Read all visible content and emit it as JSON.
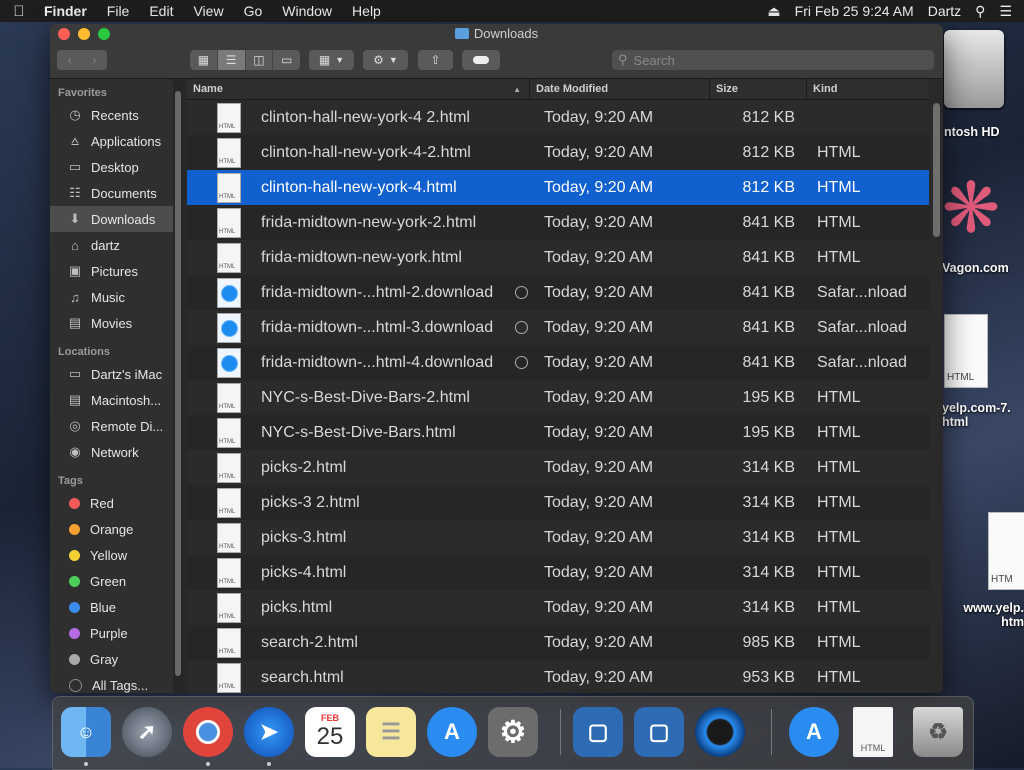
{
  "menubar": {
    "app": "Finder",
    "menus": [
      "File",
      "Edit",
      "View",
      "Go",
      "Window",
      "Help"
    ],
    "datetime": "Fri Feb 25  9:24 AM",
    "user": "Dartz"
  },
  "desktop": {
    "hd_label": "ntosh HD",
    "wagon_label": "Vagon.com",
    "doc1_label": "yelp.com-7.\nhtml",
    "doc1_tag": "HTML",
    "doc2_label": "www.yelp.\nhtm",
    "doc2_tag": "HTM"
  },
  "window": {
    "title": "Downloads",
    "search_placeholder": "Search"
  },
  "sidebar": {
    "favorites_header": "Favorites",
    "favorites": [
      {
        "label": "Recents",
        "icon": "clock-icon"
      },
      {
        "label": "Applications",
        "icon": "applications-icon"
      },
      {
        "label": "Desktop",
        "icon": "desktop-icon"
      },
      {
        "label": "Documents",
        "icon": "documents-icon"
      },
      {
        "label": "Downloads",
        "icon": "downloads-icon",
        "selected": true
      },
      {
        "label": "dartz",
        "icon": "home-icon"
      },
      {
        "label": "Pictures",
        "icon": "pictures-icon"
      },
      {
        "label": "Music",
        "icon": "music-icon"
      },
      {
        "label": "Movies",
        "icon": "movies-icon"
      }
    ],
    "locations_header": "Locations",
    "locations": [
      {
        "label": "Dartz's iMac",
        "icon": "imac-icon"
      },
      {
        "label": "Macintosh...",
        "icon": "drive-icon"
      },
      {
        "label": "Remote Di...",
        "icon": "disc-icon"
      },
      {
        "label": "Network",
        "icon": "network-icon"
      }
    ],
    "tags_header": "Tags",
    "tags": [
      {
        "label": "Red",
        "color": "#f05a5a"
      },
      {
        "label": "Orange",
        "color": "#f5a033"
      },
      {
        "label": "Yellow",
        "color": "#f4d235"
      },
      {
        "label": "Green",
        "color": "#4cd05a"
      },
      {
        "label": "Blue",
        "color": "#3c8cf0"
      },
      {
        "label": "Purple",
        "color": "#b36ae2"
      },
      {
        "label": "Gray",
        "color": "#a8a8a8"
      },
      {
        "label": "All Tags...",
        "color": ""
      }
    ]
  },
  "columns": {
    "name": "Name",
    "date": "Date Modified",
    "size": "Size",
    "kind": "Kind"
  },
  "files": [
    {
      "name": "clinton-hall-new-york-4 2.html",
      "date": "Today, 9:20 AM",
      "size": "812 KB",
      "kind": "",
      "type": "html"
    },
    {
      "name": "clinton-hall-new-york-4-2.html",
      "date": "Today, 9:20 AM",
      "size": "812 KB",
      "kind": "HTML",
      "type": "html"
    },
    {
      "name": "clinton-hall-new-york-4.html",
      "date": "Today, 9:20 AM",
      "size": "812 KB",
      "kind": "HTML",
      "type": "html",
      "selected": true
    },
    {
      "name": "frida-midtown-new-york-2.html",
      "date": "Today, 9:20 AM",
      "size": "841 KB",
      "kind": "HTML",
      "type": "html"
    },
    {
      "name": "frida-midtown-new-york.html",
      "date": "Today, 9:20 AM",
      "size": "841 KB",
      "kind": "HTML",
      "type": "html"
    },
    {
      "name": "frida-midtown-...html-2.download",
      "date": "Today, 9:20 AM",
      "size": "841 KB",
      "kind": "Safar...nload",
      "type": "download"
    },
    {
      "name": "frida-midtown-...html-3.download",
      "date": "Today, 9:20 AM",
      "size": "841 KB",
      "kind": "Safar...nload",
      "type": "download"
    },
    {
      "name": "frida-midtown-...html-4.download",
      "date": "Today, 9:20 AM",
      "size": "841 KB",
      "kind": "Safar...nload",
      "type": "download"
    },
    {
      "name": "NYC-s-Best-Dive-Bars-2.html",
      "date": "Today, 9:20 AM",
      "size": "195 KB",
      "kind": "HTML",
      "type": "html"
    },
    {
      "name": "NYC-s-Best-Dive-Bars.html",
      "date": "Today, 9:20 AM",
      "size": "195 KB",
      "kind": "HTML",
      "type": "html"
    },
    {
      "name": "picks-2.html",
      "date": "Today, 9:20 AM",
      "size": "314 KB",
      "kind": "HTML",
      "type": "html"
    },
    {
      "name": "picks-3 2.html",
      "date": "Today, 9:20 AM",
      "size": "314 KB",
      "kind": "HTML",
      "type": "html"
    },
    {
      "name": "picks-3.html",
      "date": "Today, 9:20 AM",
      "size": "314 KB",
      "kind": "HTML",
      "type": "html"
    },
    {
      "name": "picks-4.html",
      "date": "Today, 9:20 AM",
      "size": "314 KB",
      "kind": "HTML",
      "type": "html"
    },
    {
      "name": "picks.html",
      "date": "Today, 9:20 AM",
      "size": "314 KB",
      "kind": "HTML",
      "type": "html"
    },
    {
      "name": "search-2.html",
      "date": "Today, 9:20 AM",
      "size": "985 KB",
      "kind": "HTML",
      "type": "html"
    },
    {
      "name": "search.html",
      "date": "Today, 9:20 AM",
      "size": "953 KB",
      "kind": "HTML",
      "type": "html"
    }
  ],
  "dock": {
    "calendar_month": "FEB",
    "calendar_day": "25",
    "html_doc_tag": "HTML"
  }
}
